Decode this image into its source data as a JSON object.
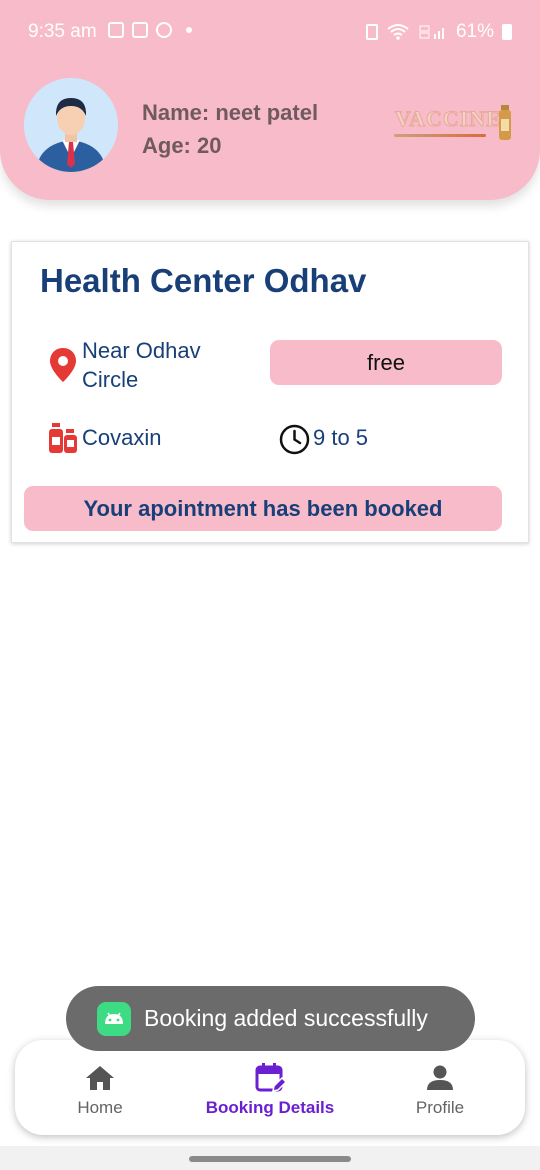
{
  "status_bar": {
    "time": "9:35 am",
    "battery": "61%"
  },
  "header": {
    "user_name": "Name: neet patel",
    "user_age": "Age: 20",
    "logo_text": "VACCINE"
  },
  "booking_card": {
    "center_name": "Health Center Odhav",
    "location": "Near Odhav Circle",
    "price": "free",
    "vaccine": "Covaxin",
    "timing": "9 to 5",
    "status_message": "Your apointment has been booked"
  },
  "toast": {
    "message": "Booking added successfully"
  },
  "bottom_nav": {
    "items": [
      {
        "label": "Home",
        "icon": "home-icon",
        "active": false
      },
      {
        "label": "Booking Details",
        "icon": "calendar-edit-icon",
        "active": true
      },
      {
        "label": "Profile",
        "icon": "person-icon",
        "active": false
      }
    ]
  },
  "colors": {
    "header_pink": "#f8bbc9",
    "primary_navy": "#183f78",
    "active_purple": "#6a1fd0",
    "location_red": "#e53935"
  }
}
